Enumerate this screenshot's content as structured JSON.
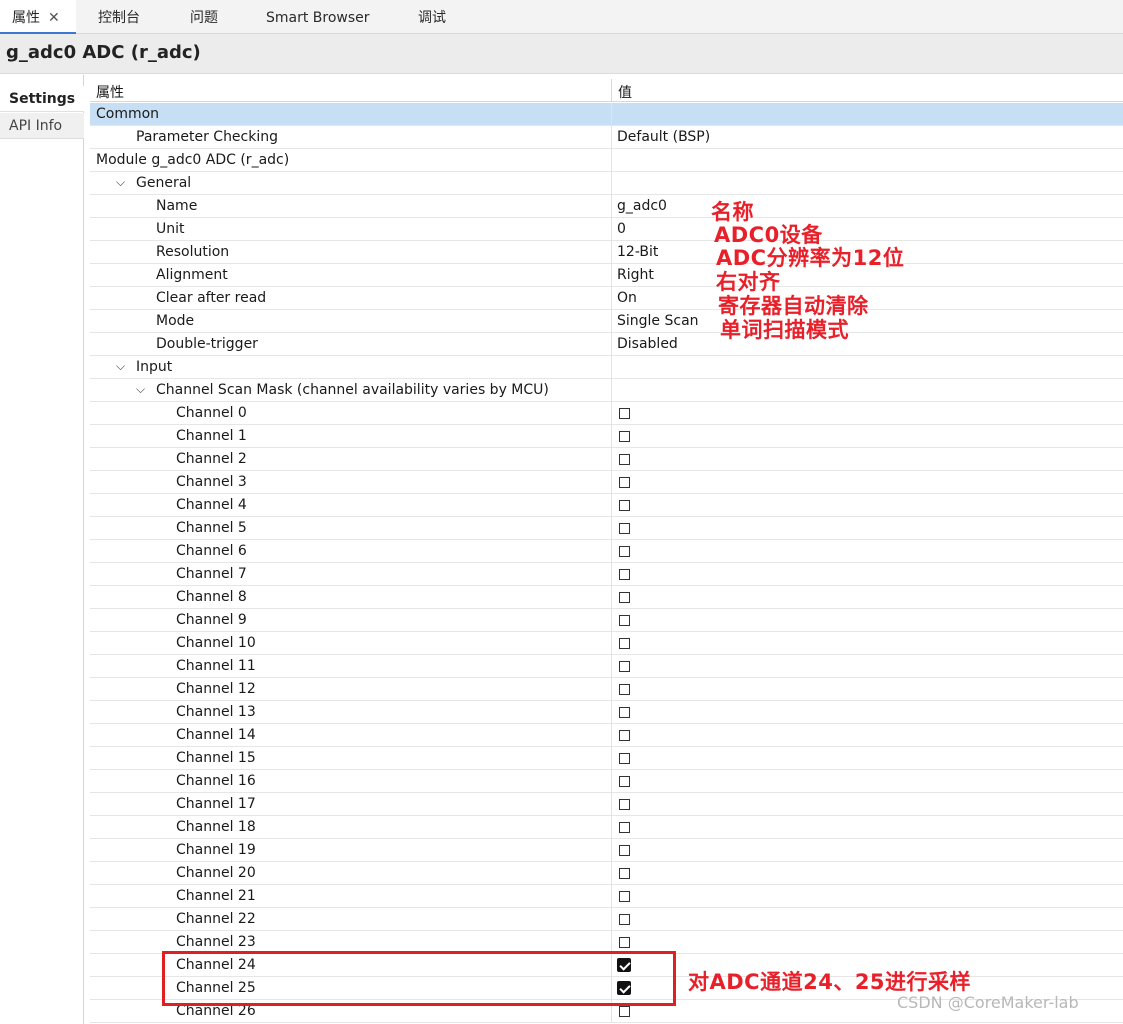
{
  "tabs": [
    {
      "label": "属性",
      "active": true
    },
    {
      "label": "控制台"
    },
    {
      "label": "问题"
    },
    {
      "label": "Smart Browser"
    },
    {
      "label": "调试"
    }
  ],
  "panel_title": "g_adc0 ADC (r_adc)",
  "side_nav": [
    "Settings",
    "API Info"
  ],
  "table": {
    "col_property": "属性",
    "col_value": "值",
    "rows": [
      {
        "name": "Common",
        "value": "",
        "level": 0,
        "expand": true,
        "selected": true
      },
      {
        "name": "Parameter Checking",
        "value": "Default (BSP)",
        "level": 1
      },
      {
        "name": "Module g_adc0 ADC (r_adc)",
        "value": "",
        "level": 0,
        "expand": true
      },
      {
        "name": "General",
        "value": "",
        "level": 1,
        "expand": true
      },
      {
        "name": "Name",
        "value": "g_adc0",
        "level": 2
      },
      {
        "name": "Unit",
        "value": "0",
        "level": 2
      },
      {
        "name": "Resolution",
        "value": "12-Bit",
        "level": 2
      },
      {
        "name": "Alignment",
        "value": "Right",
        "level": 2
      },
      {
        "name": "Clear after read",
        "value": "On",
        "level": 2
      },
      {
        "name": "Mode",
        "value": "Single Scan",
        "level": 2
      },
      {
        "name": "Double-trigger",
        "value": "Disabled",
        "level": 2
      },
      {
        "name": "Input",
        "value": "",
        "level": 1,
        "expand": true
      },
      {
        "name": "Channel Scan Mask (channel availability varies by MCU)",
        "value": "",
        "level": 2,
        "expand": true
      },
      {
        "name": "Channel 0",
        "checkbox": false,
        "level": 3
      },
      {
        "name": "Channel 1",
        "checkbox": false,
        "level": 3
      },
      {
        "name": "Channel 2",
        "checkbox": false,
        "level": 3
      },
      {
        "name": "Channel 3",
        "checkbox": false,
        "level": 3
      },
      {
        "name": "Channel 4",
        "checkbox": false,
        "level": 3
      },
      {
        "name": "Channel 5",
        "checkbox": false,
        "level": 3
      },
      {
        "name": "Channel 6",
        "checkbox": false,
        "level": 3
      },
      {
        "name": "Channel 7",
        "checkbox": false,
        "level": 3
      },
      {
        "name": "Channel 8",
        "checkbox": false,
        "level": 3
      },
      {
        "name": "Channel 9",
        "checkbox": false,
        "level": 3
      },
      {
        "name": "Channel 10",
        "checkbox": false,
        "level": 3
      },
      {
        "name": "Channel 11",
        "checkbox": false,
        "level": 3
      },
      {
        "name": "Channel 12",
        "checkbox": false,
        "level": 3
      },
      {
        "name": "Channel 13",
        "checkbox": false,
        "level": 3
      },
      {
        "name": "Channel 14",
        "checkbox": false,
        "level": 3
      },
      {
        "name": "Channel 15",
        "checkbox": false,
        "level": 3
      },
      {
        "name": "Channel 16",
        "checkbox": false,
        "level": 3
      },
      {
        "name": "Channel 17",
        "checkbox": false,
        "level": 3
      },
      {
        "name": "Channel 18",
        "checkbox": false,
        "level": 3
      },
      {
        "name": "Channel 19",
        "checkbox": false,
        "level": 3
      },
      {
        "name": "Channel 20",
        "checkbox": false,
        "level": 3
      },
      {
        "name": "Channel 21",
        "checkbox": false,
        "level": 3
      },
      {
        "name": "Channel 22",
        "checkbox": false,
        "level": 3
      },
      {
        "name": "Channel 23",
        "checkbox": false,
        "level": 3
      },
      {
        "name": "Channel 24",
        "checkbox": true,
        "level": 3
      },
      {
        "name": "Channel 25",
        "checkbox": true,
        "level": 3
      },
      {
        "name": "Channel 26",
        "checkbox": false,
        "level": 3
      }
    ]
  },
  "annotations": [
    "名称",
    "ADC0设备",
    "ADC分辨率为12位",
    "右对齐",
    "寄存器自动清除",
    "单词扫描模式",
    "对ADC通道24、25进行采样"
  ],
  "watermark": "CSDN @CoreMaker-lab",
  "colors": {
    "annotation": "#e8202a",
    "selected_row": "#c6dff5",
    "active_tab_underline": "#3b78d4"
  }
}
